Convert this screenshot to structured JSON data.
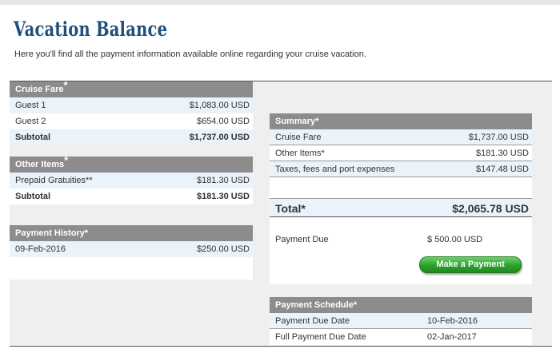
{
  "page": {
    "title": "Vacation Balance",
    "subtitle": "Here you'll find all the payment information available online regarding your cruise vacation."
  },
  "cruise_fare": {
    "header": "Cruise Fare",
    "header_mark": "*",
    "rows": [
      {
        "label": "Guest 1",
        "value": "$1,083.00 USD"
      },
      {
        "label": "Guest 2",
        "value": "$654.00 USD"
      }
    ],
    "subtotal_label": "Subtotal",
    "subtotal_value": "$1,737.00 USD"
  },
  "other_items": {
    "header": "Other Items",
    "header_mark": "*",
    "rows": [
      {
        "label": "Prepaid Gratuities**",
        "value": "$181.30 USD"
      }
    ],
    "subtotal_label": "Subtotal",
    "subtotal_value": "$181.30 USD"
  },
  "payment_history": {
    "header": "Payment History*",
    "rows": [
      {
        "label": "09-Feb-2016",
        "value": "$250.00 USD"
      }
    ]
  },
  "summary": {
    "header": "Summary*",
    "rows": [
      {
        "label": "Cruise Fare",
        "value": "$1,737.00 USD"
      },
      {
        "label": "Other Items*",
        "value": "$181.30 USD"
      },
      {
        "label": "Taxes, fees and port expenses",
        "value": "$147.48 USD"
      }
    ],
    "total_label": "Total*",
    "total_value": "$2,065.78 USD",
    "payment_due_label": "Payment Due",
    "payment_due_value": "$ 500.00 USD",
    "make_payment_label": "Make a Payment"
  },
  "payment_schedule": {
    "header": "Payment Schedule*",
    "rows": [
      {
        "label": "Payment Due Date",
        "value": "10-Feb-2016"
      },
      {
        "label": "Full Payment Due Date",
        "value": "02-Jan-2017"
      }
    ]
  },
  "colors": {
    "title": "#1f4e7a",
    "header_bg": "#8c8c8c",
    "row_alt": "#eaf3fb",
    "button_green": "#2aa12a"
  }
}
